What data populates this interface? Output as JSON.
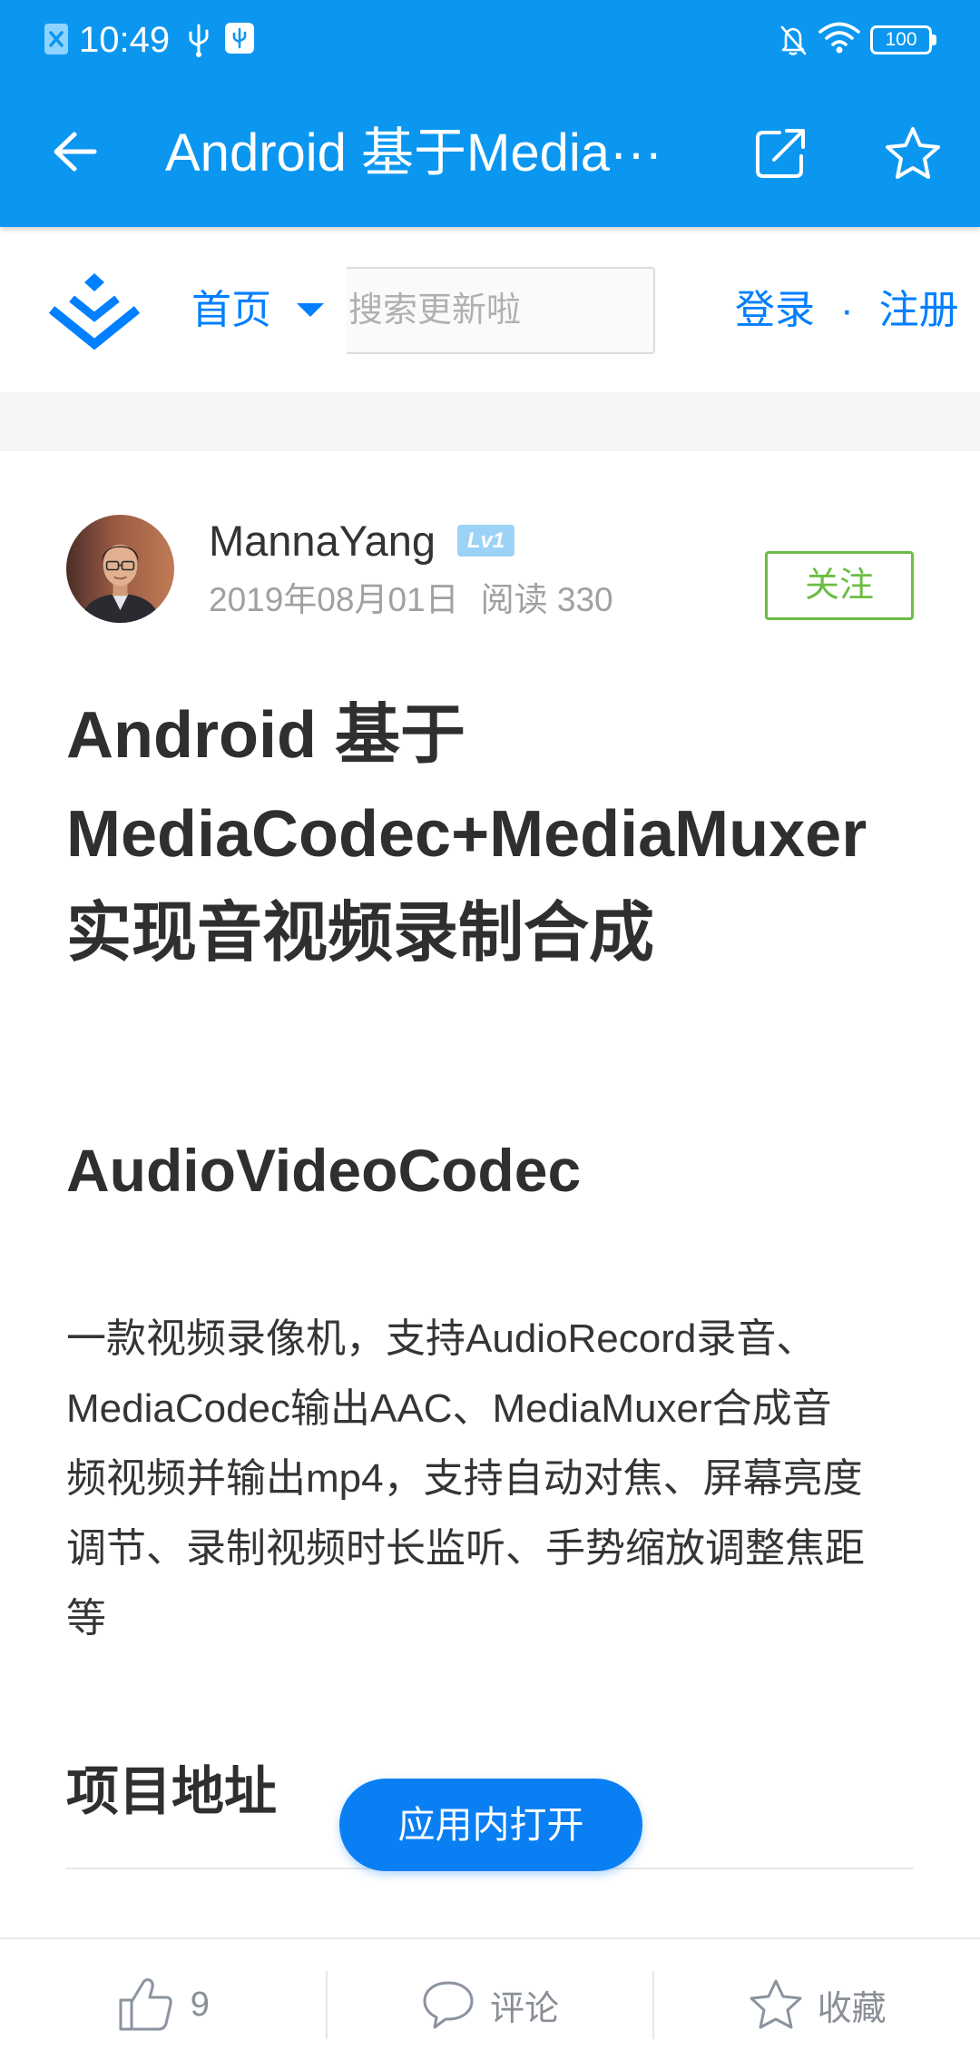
{
  "status_bar": {
    "time": "10:49",
    "battery_level": "100"
  },
  "app_bar": {
    "title": "Android 基于Media···"
  },
  "site_header": {
    "nav_label": "首页",
    "search_placeholder": "搜索更新啦",
    "login_label": "登录",
    "separator": "·",
    "register_label": "注册"
  },
  "author": {
    "name": "MannaYang",
    "level_badge": "Lv1",
    "date": "2019年08月01日",
    "reads": "阅读 330",
    "follow_label": "关注"
  },
  "article": {
    "title_lines": [
      "Android 基于",
      "MediaCodec+MediaMuxer",
      "实现音视频录制合成"
    ],
    "heading": "AudioVideoCodec",
    "paragraph_lines": [
      "一款视频录像机，支持AudioRecord录音、",
      "MediaCodec输出AAC、MediaMuxer合成音",
      "频视频并输出mp4，支持自动对焦、屏幕亮度",
      "调节、录制视频时长监听、手势缩放调整焦距",
      "等"
    ],
    "section_heading": "项目地址"
  },
  "open_in_app_label": "应用内打开",
  "bottom_bar": {
    "like_count": "9",
    "comment_label": "评论",
    "collect_label": "收藏"
  },
  "icons": {
    "status_left": [
      "notification-app-icon",
      "usb-icon",
      "usb-debug-icon"
    ],
    "status_right": [
      "bell-off-icon",
      "wifi-icon",
      "battery-icon"
    ],
    "app_bar": [
      "arrow-left-icon",
      "share-icon",
      "star-icon"
    ],
    "header": [
      "site-logo-icon",
      "caret-down-icon"
    ],
    "bottom_bar": [
      "thumb-up-icon",
      "comment-icon",
      "star-outline-icon"
    ]
  },
  "colors": {
    "bar": "#0b97f0",
    "brand": "#007fff",
    "badge": "#9dd2f7",
    "green": "#6cbd45",
    "open": "#0a7ff3"
  }
}
